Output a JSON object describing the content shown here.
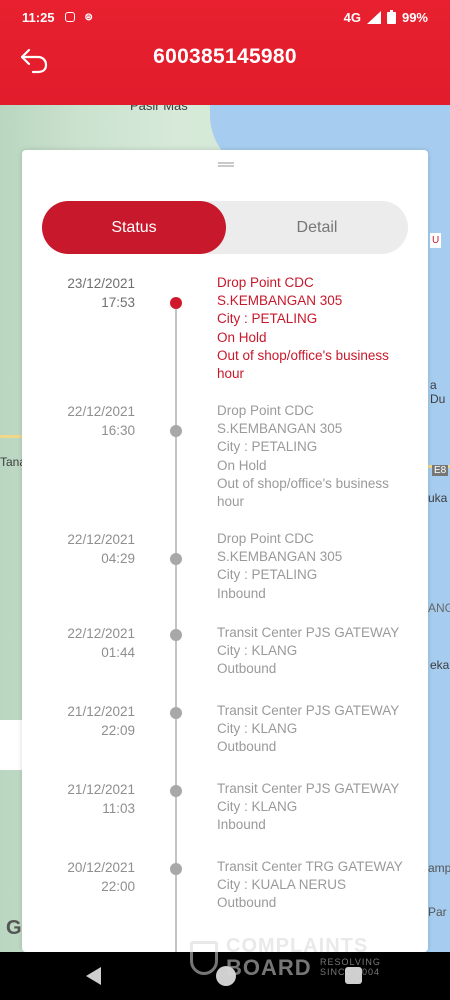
{
  "status_bar": {
    "time": "11:25",
    "network": "4G",
    "battery": "99%"
  },
  "header": {
    "title": "600385145980"
  },
  "map": {
    "labels": [
      "Pasir Mas",
      "Tana",
      "a Du",
      "E8",
      "uka",
      "ANG",
      "eka",
      "amp",
      "Par",
      "U"
    ]
  },
  "tabs": {
    "status": "Status",
    "detail": "Detail",
    "active": "Status"
  },
  "timeline": [
    {
      "date": "23/12/2021",
      "time": "17:53",
      "lines": [
        "Drop Point CDC",
        "S.KEMBANGAN 305",
        "City : PETALING",
        "On Hold",
        "Out of shop/office's business",
        "hour"
      ],
      "current": true
    },
    {
      "date": "22/12/2021",
      "time": "16:30",
      "lines": [
        "Drop Point CDC",
        "S.KEMBANGAN 305",
        "City : PETALING",
        "On Hold",
        "Out of shop/office's business",
        "hour"
      ],
      "current": false
    },
    {
      "date": "22/12/2021",
      "time": "04:29",
      "lines": [
        "Drop Point CDC",
        "S.KEMBANGAN 305",
        "City : PETALING",
        "Inbound"
      ],
      "current": false
    },
    {
      "date": "22/12/2021",
      "time": "01:44",
      "lines": [
        "Transit Center PJS GATEWAY",
        "City : KLANG",
        "Outbound"
      ],
      "current": false
    },
    {
      "date": "21/12/2021",
      "time": "22:09",
      "lines": [
        "Transit Center PJS GATEWAY",
        "City : KLANG",
        "Outbound"
      ],
      "current": false
    },
    {
      "date": "21/12/2021",
      "time": "11:03",
      "lines": [
        "Transit Center PJS GATEWAY",
        "City : KLANG",
        "Inbound"
      ],
      "current": false
    },
    {
      "date": "20/12/2021",
      "time": "22:00",
      "lines": [
        "Transit Center TRG GATEWAY",
        "City : KUALA NERUS",
        "Outbound"
      ],
      "current": false
    }
  ],
  "watermark": {
    "line1": "COMPLAINTS",
    "line2": "BOARD",
    "line3": "RESOLVING SINCE 2004"
  },
  "colors": {
    "brand_red": "#e11c2b",
    "active_red": "#c8182b",
    "muted_gray": "#9a9a9a"
  },
  "icons": {
    "back": "back-arrow-icon",
    "signal": "signal-icon",
    "battery": "battery-icon"
  }
}
